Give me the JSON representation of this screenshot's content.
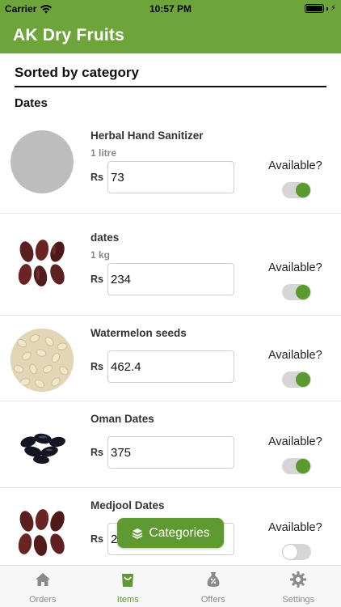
{
  "status": {
    "carrier": "Carrier",
    "time": "10:57 PM"
  },
  "app": {
    "title": "AK Dry Fruits"
  },
  "sort": {
    "title": "Sorted by category"
  },
  "section": {
    "title": "Dates"
  },
  "currency": "Rs",
  "availability_label": "Available?",
  "items": [
    {
      "name": "Herbal Hand Sanitizer",
      "unit": "1 litre",
      "price": "73",
      "available": true,
      "image": "placeholder"
    },
    {
      "name": "dates",
      "unit": "1 kg",
      "price": "234",
      "available": true,
      "image": "dates-icon"
    },
    {
      "name": "Watermelon seeds",
      "unit": "",
      "price": "462.4",
      "available": true,
      "image": "watermelon-seeds-icon"
    },
    {
      "name": "Oman Dates",
      "unit": "",
      "price": "375",
      "available": true,
      "image": "oman-dates-icon"
    },
    {
      "name": "Medjool Dates",
      "unit": "",
      "price": "2",
      "available": false,
      "image": "dates-icon"
    }
  ],
  "fab": {
    "label": "Categories"
  },
  "tabs": [
    {
      "label": "Orders",
      "icon": "home-icon"
    },
    {
      "label": "Items",
      "icon": "bag-icon",
      "active": true
    },
    {
      "label": "Offers",
      "icon": "offer-tag-icon"
    },
    {
      "label": "Settings",
      "icon": "gear-icon"
    }
  ],
  "colors": {
    "brand": "#6ea53a",
    "accent": "#5e9a31"
  }
}
